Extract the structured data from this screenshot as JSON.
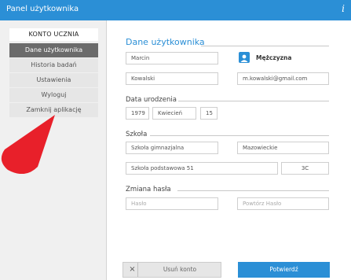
{
  "titlebar": {
    "title": "Panel użytkownika",
    "info_glyph": "i"
  },
  "sidebar": {
    "header": "KONTO UCZNIA",
    "items": [
      {
        "label": "Dane użytkownika",
        "active": true
      },
      {
        "label": "Historia badań"
      },
      {
        "label": "Ustawienia"
      },
      {
        "label": "Wyloguj"
      },
      {
        "label": "Zamknij aplikację"
      }
    ]
  },
  "user": {
    "section_title": "Dane użytkownika",
    "first_name": "Marcin",
    "last_name": "Kowalski",
    "email": "m.kowalski@gmail.com",
    "gender": "Mężczyzna"
  },
  "birth": {
    "section_title": "Data urodzenia",
    "year": "1979",
    "month": "Kwiecień",
    "day": "15"
  },
  "school": {
    "section_title": "Szkoła",
    "type": "Szkoła gimnazjalna",
    "region": "Mazowieckie",
    "name": "Szkoła podstawowa 51",
    "class": "3C"
  },
  "password": {
    "section_title": "Zmiana hasła",
    "password_placeholder": "Hasło",
    "repeat_placeholder": "Powtórz Hasło"
  },
  "actions": {
    "delete_label": "Usuń konto",
    "delete_glyph": "×",
    "confirm_label": "Potwierdź"
  },
  "colors": {
    "accent": "#2b8fd6",
    "cursor": "#e8202a"
  },
  "icons": {
    "gender": "user-icon",
    "close": "close-icon",
    "info": "info-icon"
  }
}
